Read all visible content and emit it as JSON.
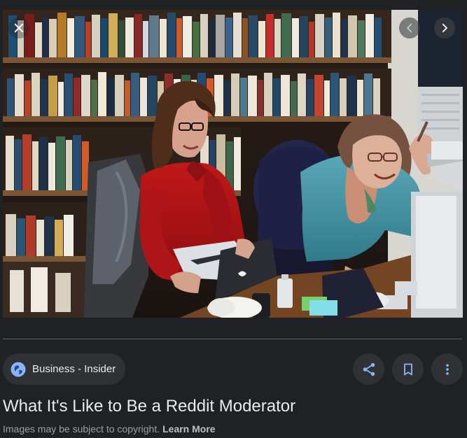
{
  "source": {
    "label": "Business - Insider",
    "icon": "globe-icon"
  },
  "article": {
    "title": "What It's Like to Be a Reddit Moderator"
  },
  "footer": {
    "notice": "Images may be subject to copyright.",
    "link_label": "Learn More"
  },
  "controls": {
    "close_icon": "close-icon",
    "prev_icon": "chevron-left-icon",
    "next_icon": "chevron-right-icon",
    "share_icon": "share-icon",
    "save_icon": "bookmark-icon",
    "more_icon": "more-vert-icon"
  },
  "colors": {
    "background": "#202124",
    "chip": "#303134",
    "text": "#e8eaed",
    "muted": "#9aa0a6",
    "accent": "#8ab4f8"
  }
}
